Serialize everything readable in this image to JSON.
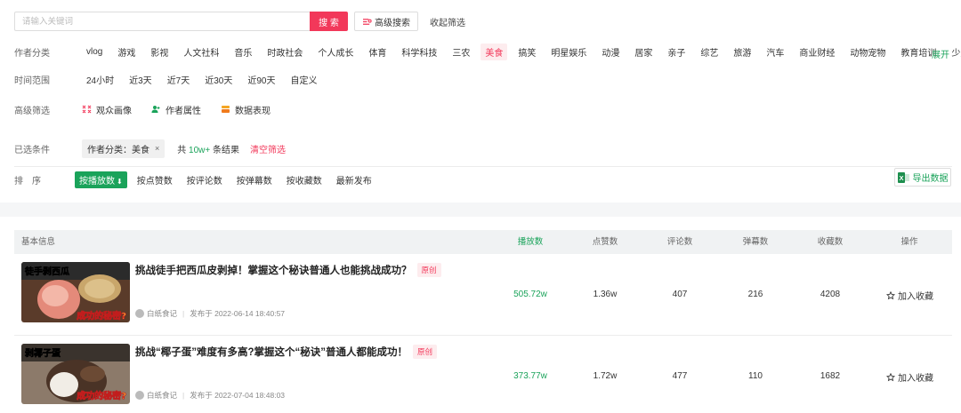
{
  "search": {
    "placeholder": "请输入关键词",
    "button": "搜 索",
    "advanced": "高级搜索",
    "collapse": "收起筛选"
  },
  "author_category": {
    "label": "作者分类",
    "options": [
      "vlog",
      "游戏",
      "影视",
      "人文社科",
      "音乐",
      "时政社会",
      "个人成长",
      "体育",
      "科学科技",
      "三农",
      "美食",
      "搞笑",
      "明星娱乐",
      "动漫",
      "居家",
      "亲子",
      "综艺",
      "旅游",
      "汽车",
      "商业财经",
      "动物宠物",
      "教育培训",
      "少儿"
    ],
    "active": "美食",
    "expand": "展开"
  },
  "time_range": {
    "label": "时间范围",
    "options": [
      "24小时",
      "近3天",
      "近7天",
      "近30天",
      "近90天",
      "自定义"
    ]
  },
  "advanced_filter": {
    "label": "高级筛选",
    "items": [
      "观众画像",
      "作者属性",
      "数据表现"
    ]
  },
  "selected": {
    "label": "已选条件",
    "chip": "作者分类：美食",
    "chip_close": "×",
    "total_prefix": "共 ",
    "total_num": "10w+",
    "total_suffix": " 条结果",
    "clear": "清空筛选"
  },
  "sort": {
    "label": "排　序",
    "options": [
      "按播放数",
      "按点赞数",
      "按评论数",
      "按弹幕数",
      "按收藏数",
      "最新发布"
    ],
    "active_mark": "⬇",
    "export": "导出数据"
  },
  "table": {
    "headers": {
      "info": "基本信息",
      "play": "播放数",
      "like": "点赞数",
      "comment": "评论数",
      "danmaku": "弹幕数",
      "favorite": "收藏数",
      "action": "操作"
    },
    "rows": [
      {
        "title": "挑战徒手把西瓜皮剥掉！掌握这个秘诀普通人也能挑战成功？",
        "badge": "原创",
        "thumb_top": "徒手剥西瓜",
        "thumb_bottom": "成功的秘密?",
        "author": "白纸食记",
        "published": "发布于 2022-06-14 18:40:57",
        "play": "505.72w",
        "like": "1.36w",
        "comment": "407",
        "danmaku": "216",
        "favorite": "4208",
        "action": "加入收藏"
      },
      {
        "title": "挑战“椰子蛋”难度有多高?掌握这个“秘诀”普通人都能成功！",
        "badge": "原创",
        "thumb_top": "剥椰子蛋",
        "thumb_bottom": "成功的秘密?",
        "author": "白纸食记",
        "published": "发布于 2022-07-04 18:48:03",
        "play": "373.77w",
        "like": "1.72w",
        "comment": "477",
        "danmaku": "110",
        "favorite": "1682",
        "action": "加入收藏"
      }
    ]
  },
  "colors": {
    "accent_red": "#f2385a",
    "accent_green": "#1aa35a"
  },
  "icons": [
    "advanced-search-icon",
    "audience-icon",
    "author-attr-icon",
    "data-icon",
    "excel-icon",
    "star-icon",
    "author-avatar-icon"
  ]
}
